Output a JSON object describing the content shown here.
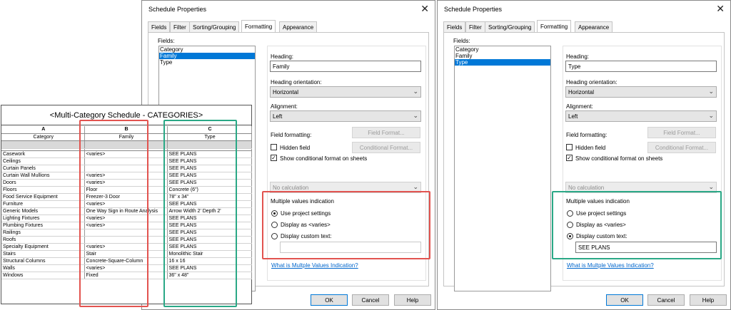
{
  "colors": {
    "red_highlight": "#e2534f",
    "teal_highlight": "#2aa886",
    "selection": "#0078d7",
    "link": "#0066cc"
  },
  "dialog_left": {
    "title": "Schedule Properties",
    "tabs": [
      "Fields",
      "Filter",
      "Sorting/Grouping",
      "Formatting",
      "Appearance"
    ],
    "active_tab": "Formatting",
    "fields_label": "Fields:",
    "fields": [
      "Category",
      "Family",
      "Type"
    ],
    "selected_field": "Family",
    "heading_label": "Heading:",
    "heading_value": "Family",
    "heading_orientation_label": "Heading orientation:",
    "heading_orientation_value": "Horizontal",
    "alignment_label": "Alignment:",
    "alignment_value": "Left",
    "field_formatting_label": "Field formatting:",
    "field_format_button": "Field Format...",
    "hidden_field_label": "Hidden field",
    "conditional_format_button": "Conditional Format...",
    "show_conditional_label": "Show conditional format on sheets",
    "calculation_value": "No calculation",
    "multiple_values_label": "Multiple values indication",
    "option_project": "Use project settings",
    "option_varies": "Display as <varies>",
    "option_custom": "Display custom text:",
    "selected_option": "project",
    "custom_text_value": "",
    "help_link": "What is Multple Values Indication?",
    "ok": "OK",
    "cancel": "Cancel",
    "help": "Help"
  },
  "dialog_right": {
    "title": "Schedule Properties",
    "tabs": [
      "Fields",
      "Filter",
      "Sorting/Grouping",
      "Formatting",
      "Appearance"
    ],
    "active_tab": "Formatting",
    "fields_label": "Fields:",
    "fields": [
      "Category",
      "Family",
      "Type"
    ],
    "selected_field": "Type",
    "heading_label": "Heading:",
    "heading_value": "Type",
    "heading_orientation_label": "Heading orientation:",
    "heading_orientation_value": "Horizontal",
    "alignment_label": "Alignment:",
    "alignment_value": "Left",
    "field_formatting_label": "Field formatting:",
    "field_format_button": "Field Format...",
    "hidden_field_label": "Hidden field",
    "conditional_format_button": "Conditional Format...",
    "show_conditional_label": "Show conditional format on sheets",
    "calculation_value": "No calculation",
    "multiple_values_label": "Multiple values indication",
    "option_project": "Use project settings",
    "option_varies": "Display as <varies>",
    "option_custom": "Display custom text:",
    "selected_option": "custom",
    "custom_text_value": "SEE PLANS",
    "help_link": "What is Multple Values Indication?",
    "ok": "OK",
    "cancel": "Cancel",
    "help": "Help"
  },
  "schedule": {
    "title": "<Multi-Category Schedule - CATEGORIES>",
    "column_letters": [
      "A",
      "B",
      "C"
    ],
    "column_headers": [
      "Category",
      "Family",
      "Type"
    ],
    "rows": [
      [
        "Casework",
        "<varies>",
        "SEE PLANS"
      ],
      [
        "Ceilings",
        "",
        "SEE PLANS"
      ],
      [
        "Curtain Panels",
        "",
        "SEE PLANS"
      ],
      [
        "Curtain Wall Mullions",
        "<varies>",
        "SEE PLANS"
      ],
      [
        "Doors",
        "<varies>",
        "SEE PLANS"
      ],
      [
        "Floors",
        "Floor",
        "Concrete (6\")"
      ],
      [
        "Food Service Equipment",
        "Freezer-3 Door",
        "78\" x 34\""
      ],
      [
        "Furniture",
        "<varies>",
        "SEE PLANS"
      ],
      [
        "Generic Models",
        "One Way Sign in Route Analysis",
        "Arrow Width 2' Depth 2'"
      ],
      [
        "Lighting Fixtures",
        "<varies>",
        "SEE PLANS"
      ],
      [
        "Plumbing Fixtures",
        "<varies>",
        "SEE PLANS"
      ],
      [
        "Railings",
        "",
        "SEE PLANS"
      ],
      [
        "Roofs",
        "",
        "SEE PLANS"
      ],
      [
        "Specialty Equipment",
        "<varies>",
        "SEE PLANS"
      ],
      [
        "Stairs",
        "Stair",
        "Monolithic Stair"
      ],
      [
        "Structural Columns",
        "Concrete-Square-Column",
        "16 x 16"
      ],
      [
        "Walls",
        "<varies>",
        "SEE PLANS"
      ],
      [
        "Windows",
        "Fixed",
        "36\" x 48\""
      ]
    ]
  }
}
